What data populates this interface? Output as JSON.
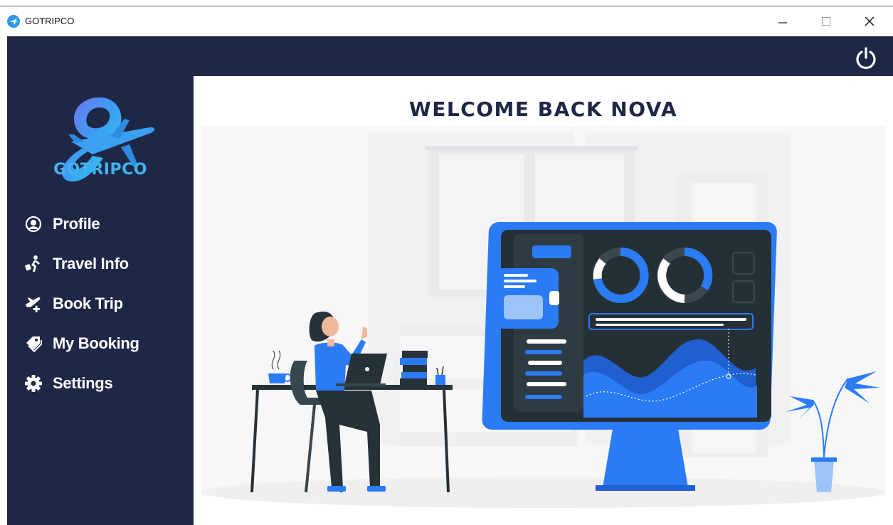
{
  "window": {
    "title": "GOTRIPCO",
    "controls": {
      "minimize": "—",
      "maximize": "☐",
      "close": "✕"
    }
  },
  "logo": {
    "text": "GOTRIPCO",
    "icon": "airplane-logo-icon"
  },
  "header": {
    "power_icon": "power-icon"
  },
  "nav": {
    "items": [
      {
        "label": "Profile",
        "icon": "user-circle-icon"
      },
      {
        "label": "Travel Info",
        "icon": "traveler-icon"
      },
      {
        "label": "Book Trip",
        "icon": "plane-plus-icon"
      },
      {
        "label": "My Booking",
        "icon": "tags-icon"
      },
      {
        "label": "Settings",
        "icon": "gear-icon"
      }
    ]
  },
  "main": {
    "welcome": "WELCOME BACK NOVA"
  },
  "colors": {
    "sidebar": "#1f2747",
    "accent": "#2b7bf5",
    "logo_blue": "#40b4f0",
    "text_white": "#ffffff"
  }
}
